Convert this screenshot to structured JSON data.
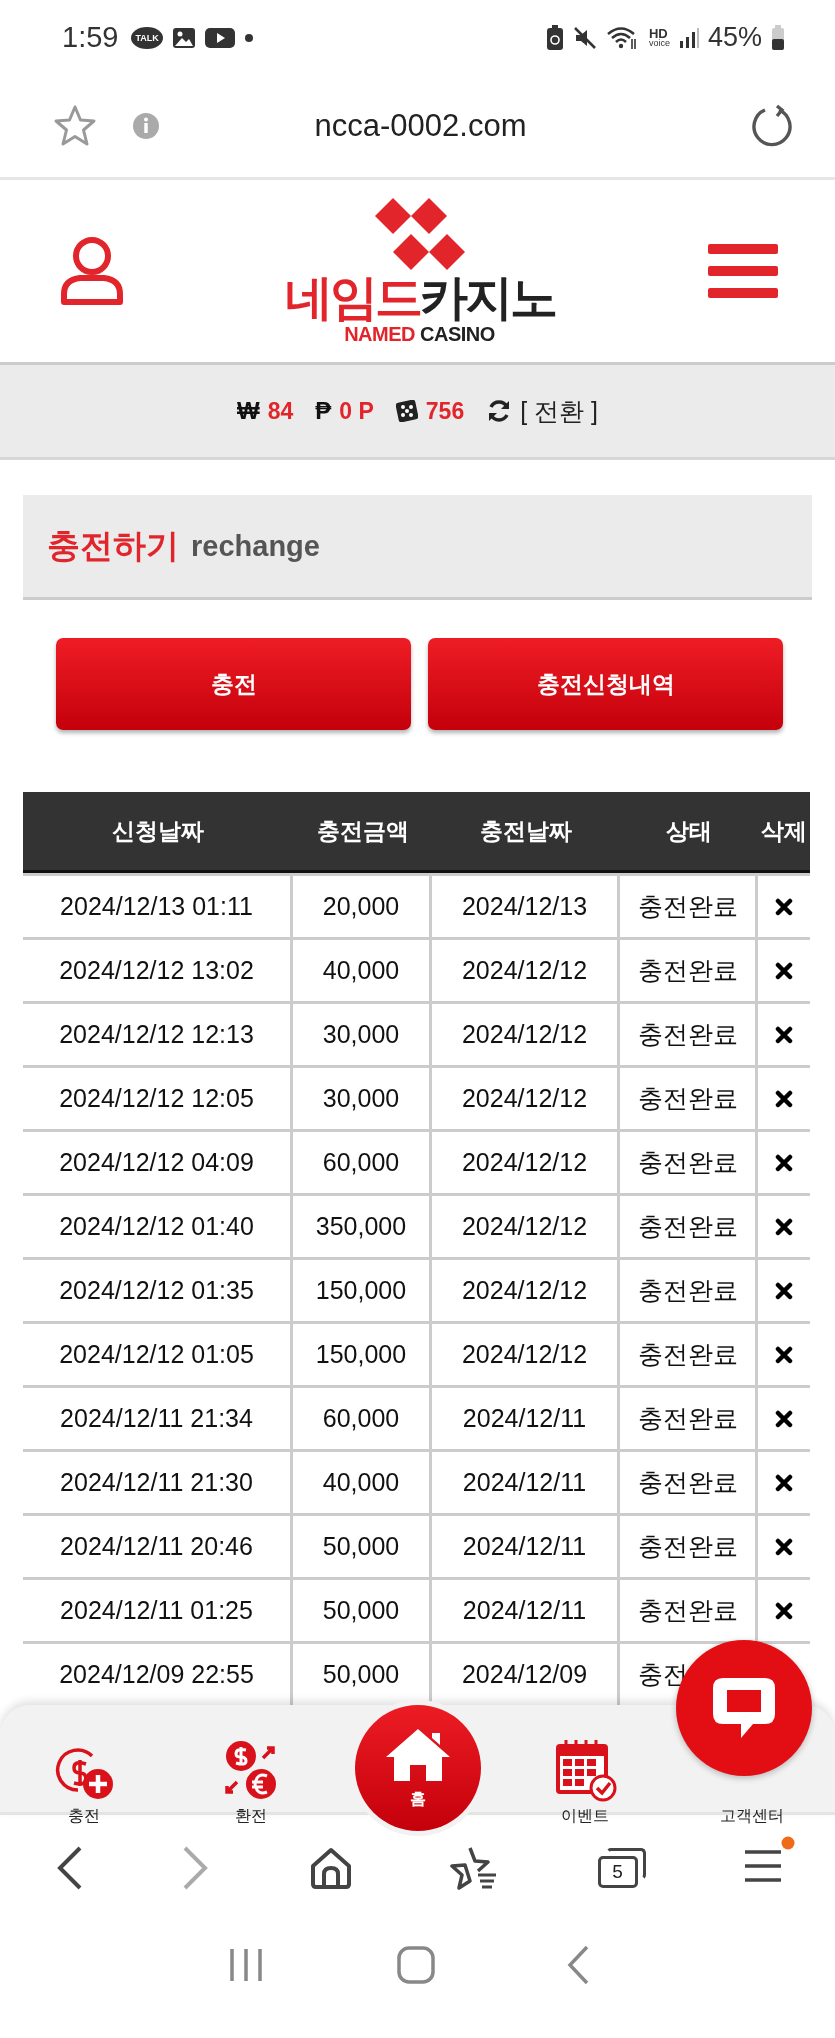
{
  "status_bar": {
    "time": "1:59",
    "talk_label": "TALK",
    "hd_label": "HD",
    "voice_label": "voice",
    "battery": "45%"
  },
  "browser": {
    "url": "ncca-0002.com",
    "tab_count": "5",
    "menu_badge": true
  },
  "logo": {
    "name_red": "네임드",
    "name_dark": "카지노",
    "sub_red": "NAMED",
    "sub_dark": "CASINO"
  },
  "balance": [
    {
      "kind": "currency",
      "symbol": "₩",
      "value": "84"
    },
    {
      "kind": "currency",
      "symbol": "₱",
      "value": "0 P"
    },
    {
      "kind": "dice",
      "value": "756"
    }
  ],
  "convert": "[ 전환 ]",
  "section": {
    "title": "충전하기",
    "subtitle": "rechange"
  },
  "buttons": [
    "충전",
    "충전신청내역"
  ],
  "table": {
    "columns": [
      "신청날짜",
      "충전금액",
      "충전날짜",
      "상태",
      "삭제"
    ],
    "rows": [
      {
        "requested": "2024/12/13 01:11",
        "amount": "20,000",
        "charged": "2024/12/13",
        "status": "충전완료",
        "delete_icon": true
      },
      {
        "requested": "2024/12/12 13:02",
        "amount": "40,000",
        "charged": "2024/12/12",
        "status": "충전완료",
        "delete_icon": true
      },
      {
        "requested": "2024/12/12 12:13",
        "amount": "30,000",
        "charged": "2024/12/12",
        "status": "충전완료",
        "delete_icon": true
      },
      {
        "requested": "2024/12/12 12:05",
        "amount": "30,000",
        "charged": "2024/12/12",
        "status": "충전완료",
        "delete_icon": true
      },
      {
        "requested": "2024/12/12 04:09",
        "amount": "60,000",
        "charged": "2024/12/12",
        "status": "충전완료",
        "delete_icon": true
      },
      {
        "requested": "2024/12/12 01:40",
        "amount": "350,000",
        "charged": "2024/12/12",
        "status": "충전완료",
        "delete_icon": true
      },
      {
        "requested": "2024/12/12 01:35",
        "amount": "150,000",
        "charged": "2024/12/12",
        "status": "충전완료",
        "delete_icon": true
      },
      {
        "requested": "2024/12/12 01:05",
        "amount": "150,000",
        "charged": "2024/12/12",
        "status": "충전완료",
        "delete_icon": true
      },
      {
        "requested": "2024/12/11 21:34",
        "amount": "60,000",
        "charged": "2024/12/11",
        "status": "충전완료",
        "delete_icon": true
      },
      {
        "requested": "2024/12/11 21:30",
        "amount": "40,000",
        "charged": "2024/12/11",
        "status": "충전완료",
        "delete_icon": true
      },
      {
        "requested": "2024/12/11 20:46",
        "amount": "50,000",
        "charged": "2024/12/11",
        "status": "충전완료",
        "delete_icon": true
      },
      {
        "requested": "2024/12/11 01:25",
        "amount": "50,000",
        "charged": "2024/12/11",
        "status": "충전완료",
        "delete_icon": true
      },
      {
        "requested": "2024/12/09 22:55",
        "amount": "50,000",
        "charged": "2024/12/09",
        "status": "충전",
        "delete_icon": false
      }
    ]
  },
  "bottom_nav": [
    {
      "kind": "charge",
      "label": "충전"
    },
    {
      "kind": "exchange",
      "label": "환전"
    },
    {
      "kind": "home",
      "label": "홈"
    },
    {
      "kind": "event",
      "label": "이벤트"
    },
    {
      "kind": "support",
      "label": "고객센터"
    }
  ]
}
